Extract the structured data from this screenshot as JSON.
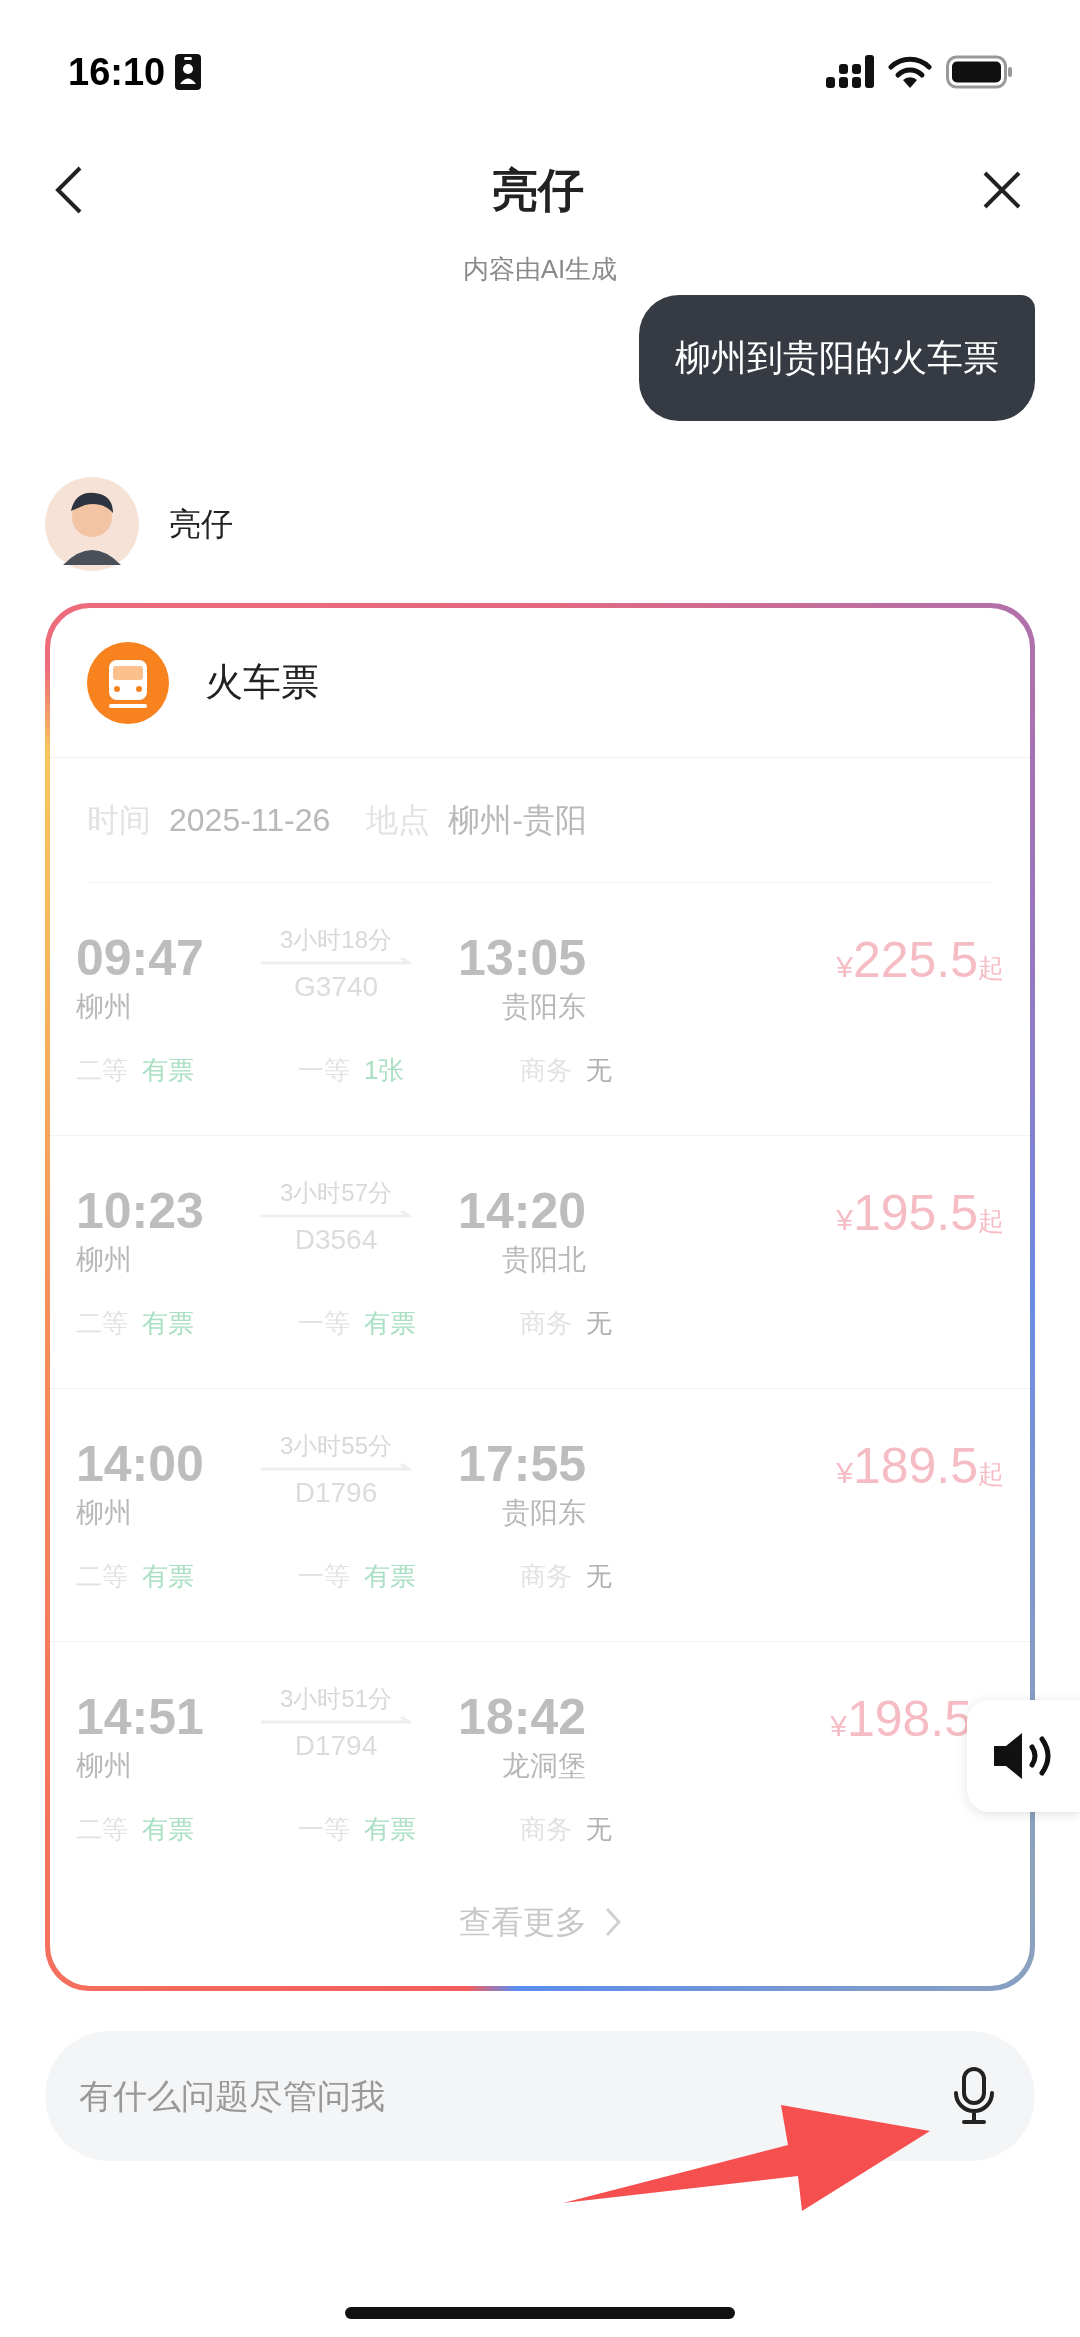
{
  "status_bar": {
    "time": "16:10"
  },
  "header": {
    "title": "亮仔"
  },
  "ai_notice": "内容由AI生成",
  "user_message": "柳州到贵阳的火车票",
  "bot": {
    "name": "亮仔"
  },
  "card": {
    "title": "火车票",
    "date_label": "时间",
    "date": "2025-11-26",
    "place_label": "地点",
    "place": "柳州-贵阳",
    "trains": [
      {
        "depart": "09:47",
        "from": "柳州",
        "duration": "3小时18分",
        "number": "G3740",
        "arrive": "13:05",
        "to": "贵阳东",
        "currency": "¥",
        "price": "225.5",
        "suffix": "起",
        "seats": [
          {
            "label": "二等",
            "status": "有票",
            "available": true
          },
          {
            "label": "一等",
            "status": "1张",
            "available": true
          },
          {
            "label": "商务",
            "status": "无",
            "available": false
          }
        ]
      },
      {
        "depart": "10:23",
        "from": "柳州",
        "duration": "3小时57分",
        "number": "D3564",
        "arrive": "14:20",
        "to": "贵阳北",
        "currency": "¥",
        "price": "195.5",
        "suffix": "起",
        "seats": [
          {
            "label": "二等",
            "status": "有票",
            "available": true
          },
          {
            "label": "一等",
            "status": "有票",
            "available": true
          },
          {
            "label": "商务",
            "status": "无",
            "available": false
          }
        ]
      },
      {
        "depart": "14:00",
        "from": "柳州",
        "duration": "3小时55分",
        "number": "D1796",
        "arrive": "17:55",
        "to": "贵阳东",
        "currency": "¥",
        "price": "189.5",
        "suffix": "起",
        "seats": [
          {
            "label": "二等",
            "status": "有票",
            "available": true
          },
          {
            "label": "一等",
            "status": "有票",
            "available": true
          },
          {
            "label": "商务",
            "status": "无",
            "available": false
          }
        ]
      },
      {
        "depart": "14:51",
        "from": "柳州",
        "duration": "3小时51分",
        "number": "D1794",
        "arrive": "18:42",
        "to": "龙洞堡",
        "currency": "¥",
        "price": "198.5",
        "seats": [
          {
            "label": "二等",
            "status": "有票",
            "available": true
          },
          {
            "label": "一等",
            "status": "有票",
            "available": true
          },
          {
            "label": "商务",
            "status": "无",
            "available": false
          }
        ]
      }
    ],
    "more": "查看更多"
  },
  "input": {
    "placeholder": "有什么问题尽管问我"
  }
}
